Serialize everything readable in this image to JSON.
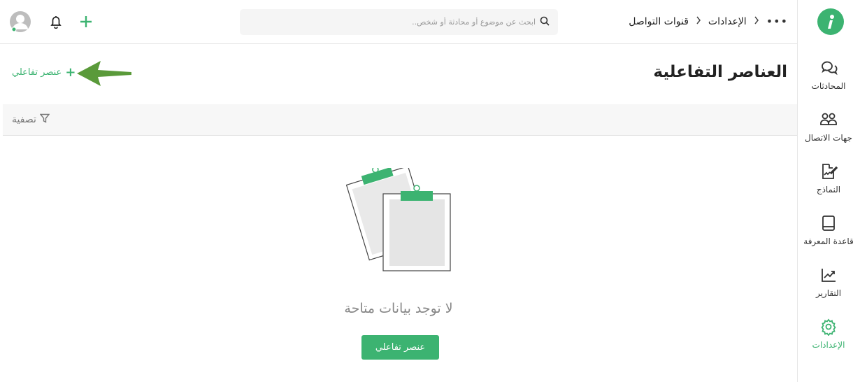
{
  "sidebar": {
    "items": [
      {
        "label": "المحادثات",
        "icon": "chat-bubbles-icon"
      },
      {
        "label": "جهات الاتصال",
        "icon": "contacts-icon"
      },
      {
        "label": "النماذج",
        "icon": "form-edit-icon"
      },
      {
        "label": "قاعدة المعرفة",
        "icon": "book-icon"
      },
      {
        "label": "التقارير",
        "icon": "chart-icon"
      },
      {
        "label": "الإعدادات",
        "icon": "gear-icon"
      }
    ],
    "active": "الإعدادات"
  },
  "topbar": {
    "breadcrumb": [
      "الإعدادات",
      "قنوات التواصل"
    ],
    "more": "•••",
    "search_placeholder": "ابحث عن موضوع أو محادثة أو شخص..",
    "icons": [
      "add-icon",
      "bell-icon",
      "avatar"
    ]
  },
  "main": {
    "title": "العناصر التفاعلية",
    "add_label": "عنصر تفاعلي",
    "add_plus": "+",
    "filter_label": "تصفية",
    "empty_text": "لا توجد بيانات متاحة",
    "empty_button": "عنصر تفاعلي"
  },
  "colors": {
    "accent": "#3cb371",
    "arrow": "#5a9a3a",
    "border": "#e6e6e6",
    "filter_bg": "#f7f7f7"
  }
}
